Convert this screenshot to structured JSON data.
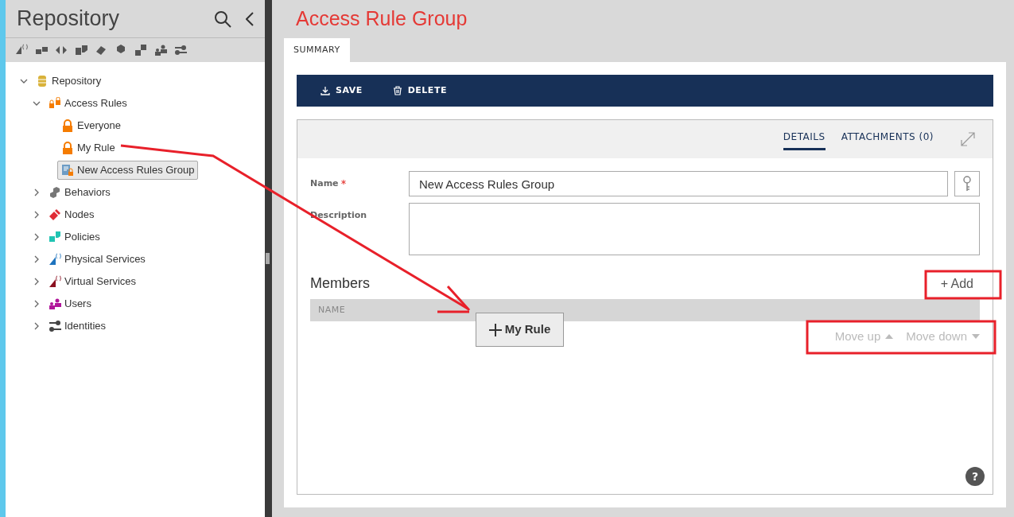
{
  "sidebar": {
    "title": "Repository",
    "tree": [
      {
        "label": "Repository",
        "kind": "database",
        "expanded": true,
        "selected": false,
        "children": [
          {
            "label": "Access Rules",
            "kind": "access-rules",
            "expanded": true,
            "selected": false,
            "children": [
              {
                "label": "Everyone",
                "kind": "lock",
                "selected": false
              },
              {
                "label": "My Rule",
                "kind": "lock",
                "selected": false
              },
              {
                "label": "New Access Rules Group",
                "kind": "group",
                "selected": true
              }
            ]
          },
          {
            "label": "Behaviors",
            "kind": "behaviors",
            "expanded": false,
            "selected": false
          },
          {
            "label": "Nodes",
            "kind": "nodes",
            "expanded": false,
            "selected": false
          },
          {
            "label": "Policies",
            "kind": "policies",
            "expanded": false,
            "selected": false
          },
          {
            "label": "Physical Services",
            "kind": "physical",
            "expanded": false,
            "selected": false
          },
          {
            "label": "Virtual Services",
            "kind": "virtual",
            "expanded": false,
            "selected": false
          },
          {
            "label": "Users",
            "kind": "users",
            "expanded": false,
            "selected": false
          },
          {
            "label": "Identities",
            "kind": "identities",
            "expanded": false,
            "selected": false
          }
        ]
      }
    ]
  },
  "main": {
    "title": "Access Rule Group",
    "tabs": [
      {
        "label": "SUMMARY",
        "selected": true
      }
    ],
    "toolbar": [
      {
        "label": "SAVE",
        "kind": "save"
      },
      {
        "label": "DELETE",
        "kind": "delete"
      }
    ],
    "detail_tabs": [
      {
        "label": "DETAILS",
        "selected": true
      },
      {
        "label": "ATTACHMENTS (0)",
        "selected": false
      }
    ],
    "name_field": {
      "label": "Name",
      "required": true,
      "value": "New Access Rules Group"
    },
    "description_field": {
      "label": "Description"
    },
    "members": {
      "title": "Members",
      "add": "+ Add",
      "columns": [
        "NAME"
      ],
      "move_up": "Move up",
      "move_down": "Move down",
      "move_disabled": true
    },
    "drag_item": {
      "label": "My Rule"
    },
    "help": "?"
  }
}
